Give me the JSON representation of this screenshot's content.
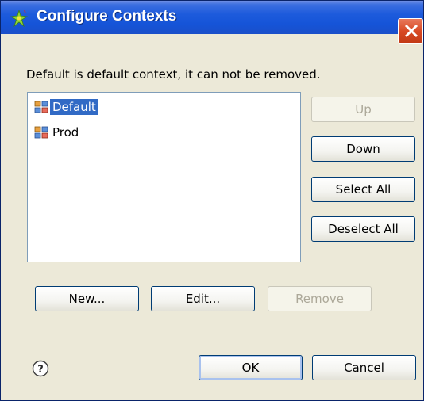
{
  "window": {
    "title": "Configure Contexts",
    "icon": "sparkle-icon",
    "close_icon": "close-icon"
  },
  "message": "Default is default context, it can not be removed.",
  "contexts": [
    {
      "label": "Default",
      "icon": "context-icon",
      "selected": true
    },
    {
      "label": "Prod",
      "icon": "context-icon",
      "selected": false
    }
  ],
  "side_buttons": {
    "up": {
      "label": "Up",
      "enabled": false
    },
    "down": {
      "label": "Down",
      "enabled": true
    },
    "select_all": {
      "label": "Select All",
      "enabled": true
    },
    "deselect_all": {
      "label": "Deselect All",
      "enabled": true
    }
  },
  "bottom_buttons": {
    "new": {
      "label": "New...",
      "enabled": true
    },
    "edit": {
      "label": "Edit...",
      "enabled": true
    },
    "remove": {
      "label": "Remove",
      "enabled": false
    }
  },
  "footer": {
    "help_icon": "help-icon",
    "ok": {
      "label": "OK",
      "enabled": true
    },
    "cancel": {
      "label": "Cancel",
      "enabled": true
    }
  },
  "colors": {
    "titlebar": "#1554d8",
    "dialog_bg": "#ece9d8",
    "selection": "#316ac5",
    "close_button": "#d94a25"
  }
}
